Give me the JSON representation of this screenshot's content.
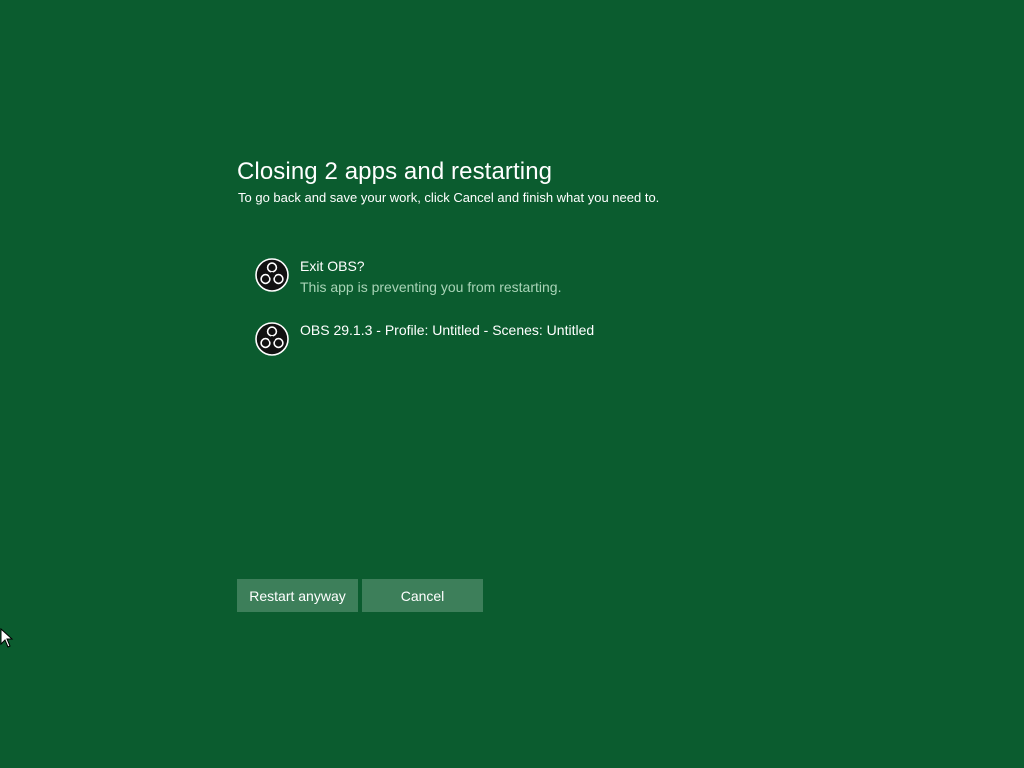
{
  "dialog": {
    "title": "Closing 2 apps and restarting",
    "subtitle": "To go back and save your work, click Cancel and finish what you need to."
  },
  "apps": [
    {
      "title": "Exit OBS?",
      "description": "This app is preventing you from restarting.",
      "icon": "obs-icon"
    },
    {
      "title": "OBS 29.1.3 - Profile: Untitled - Scenes: Untitled",
      "description": "",
      "icon": "obs-icon"
    }
  ],
  "buttons": {
    "restart_label": "Restart anyway",
    "cancel_label": "Cancel"
  },
  "colors": {
    "background": "#0b5c2f",
    "button": "#3d7f5a",
    "secondary_text": "#a9d4b7"
  }
}
